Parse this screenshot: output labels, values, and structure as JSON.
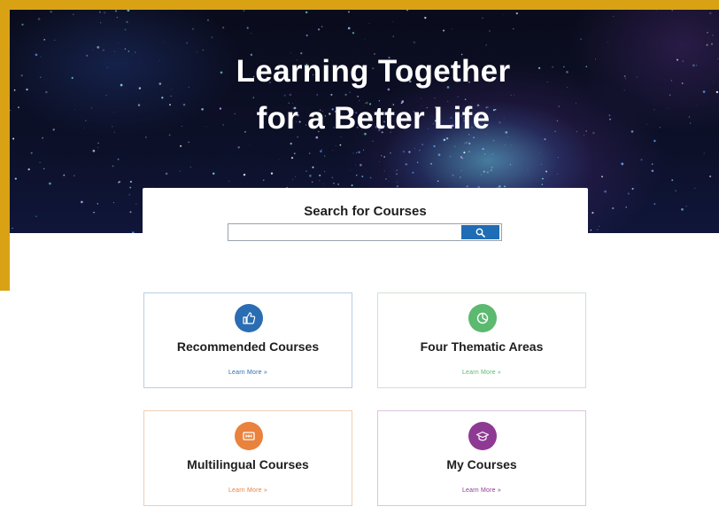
{
  "hero": {
    "title_line1": "Learning Together",
    "title_line2": "for a Better Life"
  },
  "search": {
    "label": "Search for Courses",
    "placeholder": "",
    "value": "",
    "button_icon": "search-icon"
  },
  "cards": [
    {
      "title": "Recommended Courses",
      "link": "Learn More »",
      "icon": "thumbs-up-icon",
      "color": "#2a6db3"
    },
    {
      "title": "Four Thematic Areas",
      "link": "Learn More »",
      "icon": "pie-chart-icon",
      "color": "#5bb970"
    },
    {
      "title": "Multilingual Courses",
      "link": "Learn More »",
      "icon": "language-icon",
      "color": "#e9823d"
    },
    {
      "title": "My Courses",
      "link": "Learn More »",
      "icon": "graduation-cap-icon",
      "color": "#8e3a93"
    }
  ],
  "colors": {
    "frame": "#d9a215",
    "search_button": "#1f6db5"
  }
}
